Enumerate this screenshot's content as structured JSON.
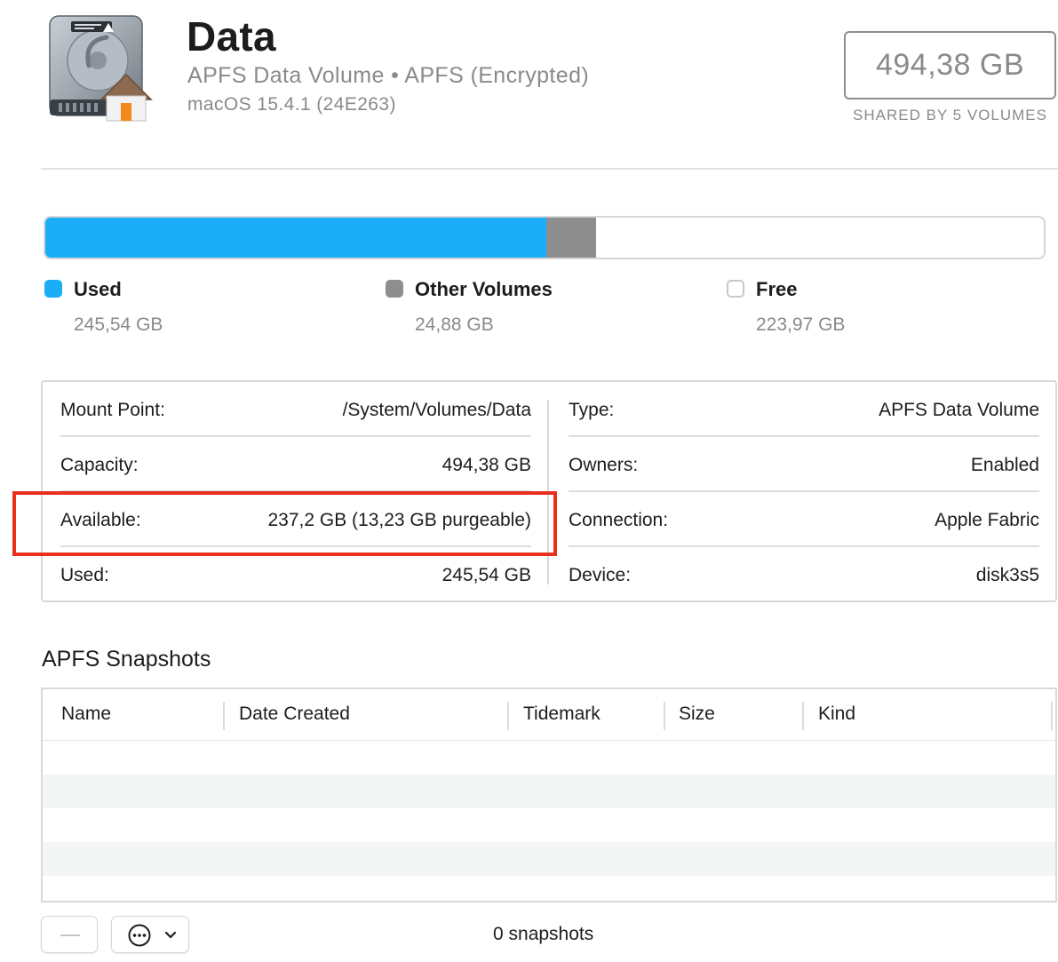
{
  "header": {
    "volume_name": "Data",
    "volume_subtitle": "APFS Data Volume • APFS (Encrypted)",
    "os_version": "macOS 15.4.1 (24E263)",
    "capacity": "494,38 GB",
    "shared_label": "SHARED BY 5 VOLUMES",
    "icon": "internal-data-disk-icon"
  },
  "usage": {
    "colors": {
      "used": "#1badf8",
      "other": "#8e8e8e",
      "free": "#ffffff"
    },
    "legend": [
      {
        "label": "Used",
        "value": "245,54 GB"
      },
      {
        "label": "Other Volumes",
        "value": "24,88 GB"
      },
      {
        "label": "Free",
        "value": "223,97 GB"
      }
    ]
  },
  "info": {
    "left": [
      {
        "key": "Mount Point:",
        "value": "/System/Volumes/Data"
      },
      {
        "key": "Capacity:",
        "value": "494,38 GB"
      },
      {
        "key": "Available:",
        "value": "237,2 GB (13,23 GB purgeable)"
      },
      {
        "key": "Used:",
        "value": "245,54 GB"
      }
    ],
    "right": [
      {
        "key": "Type:",
        "value": "APFS Data Volume"
      },
      {
        "key": "Owners:",
        "value": "Enabled"
      },
      {
        "key": "Connection:",
        "value": "Apple Fabric"
      },
      {
        "key": "Device:",
        "value": "disk3s5"
      }
    ],
    "highlight_color": "#e8301c"
  },
  "snapshots": {
    "title": "APFS Snapshots",
    "columns": [
      "Name",
      "Date Created",
      "Tidemark",
      "Size",
      "Kind"
    ],
    "count_label": "0 snapshots",
    "remove_icon": "minus-icon",
    "action_icon": "ellipsis-circle-icon"
  }
}
